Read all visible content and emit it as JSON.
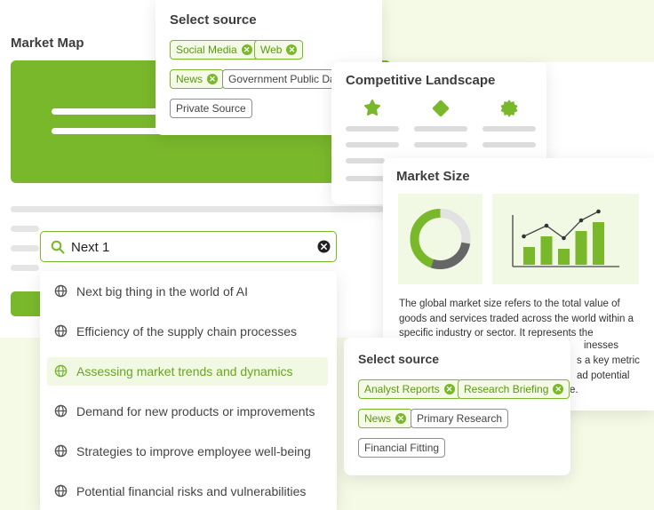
{
  "market_map": {
    "title": "Market Map"
  },
  "source_top": {
    "title": "Select source",
    "chips": [
      {
        "label": "Social Media",
        "selected": true
      },
      {
        "label": "Web",
        "selected": true
      },
      {
        "label": "News",
        "selected": true
      },
      {
        "label": "Government Public Data",
        "selected": false
      },
      {
        "label": "Private Source",
        "selected": false
      }
    ]
  },
  "competitive": {
    "title": "Competitive Landscape",
    "icons": [
      "flower-icon",
      "diamond-icon",
      "badge-icon"
    ]
  },
  "market_size": {
    "title": "Market Size",
    "description": "The global market size refers to the total value of goods and services traded across the world within a specific industry or sector. It represents the",
    "visible_fragments": [
      "inesses",
      "s a key metric",
      "ad potential",
      "e."
    ],
    "donut_fraction": 0.75,
    "bars": [
      20,
      32,
      18,
      38,
      48
    ]
  },
  "search": {
    "value": "Next 1",
    "icon": "search-icon",
    "clear_icon": "close-icon"
  },
  "suggestions": [
    {
      "label": "Next big thing in the world of AI",
      "active": false
    },
    {
      "label": "Efficiency of the supply chain processes",
      "active": false
    },
    {
      "label": "Assessing market trends and dynamics",
      "active": true
    },
    {
      "label": "Demand for new products or improvements",
      "active": false
    },
    {
      "label": "Strategies to improve employee well-being",
      "active": false
    },
    {
      "label": "Potential financial risks and vulnerabilities",
      "active": false
    }
  ],
  "source_bottom": {
    "title": "Select source",
    "chips": [
      {
        "label": "Analyst Reports",
        "selected": true
      },
      {
        "label": "Research Briefing",
        "selected": true
      },
      {
        "label": "News",
        "selected": true
      },
      {
        "label": "Primary Research",
        "selected": false
      },
      {
        "label": "Financial Fitting",
        "selected": false
      }
    ]
  },
  "colors": {
    "accent": "#7ab82b",
    "accent_light": "#f1f8e4",
    "background": "#f4fae6"
  }
}
